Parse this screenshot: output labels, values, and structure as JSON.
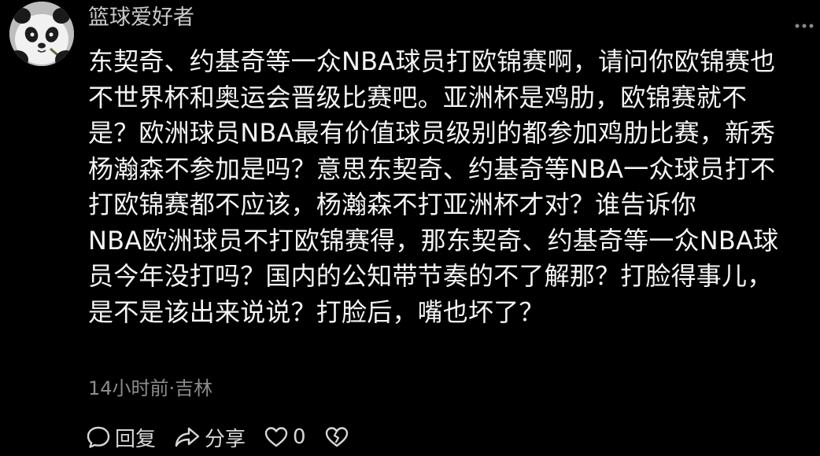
{
  "comment": {
    "username": "篮球爱好者",
    "body_lines": [
      "东契奇、约基奇等一众NBA球员打欧锦赛啊，请问你欧锦赛也",
      "不世界杯和奥运会晋级比赛吧。亚洲杯是鸡肋，欧锦赛就不",
      "是？欧洲球员NBA最有价值球员级别的都参加鸡肋比赛，新秀",
      "杨瀚森不参加是吗？意思东契奇、约基奇等NBA一众球员打不",
      "打欧锦赛都不应该，杨瀚森不打亚洲杯才对？谁告诉你",
      "NBA欧洲球员不打欧锦赛得，那东契奇、约基奇等一众NBA球",
      "员今年没打吗？国内的公知带节奏的不了解那？打脸得事儿，",
      "是不是该出来说说？打脸后，嘴也坏了？"
    ],
    "time_location": "14小时前·吉林",
    "actions": {
      "reply_label": "回复",
      "share_label": "分享",
      "like_count": "0"
    },
    "icons": {
      "avatar": "panda-avatar",
      "more": "more-dots-icon",
      "reply": "chat-bubble-icon",
      "share": "share-arrow-icon",
      "like": "heart-icon",
      "dislike": "broken-heart-icon"
    }
  }
}
